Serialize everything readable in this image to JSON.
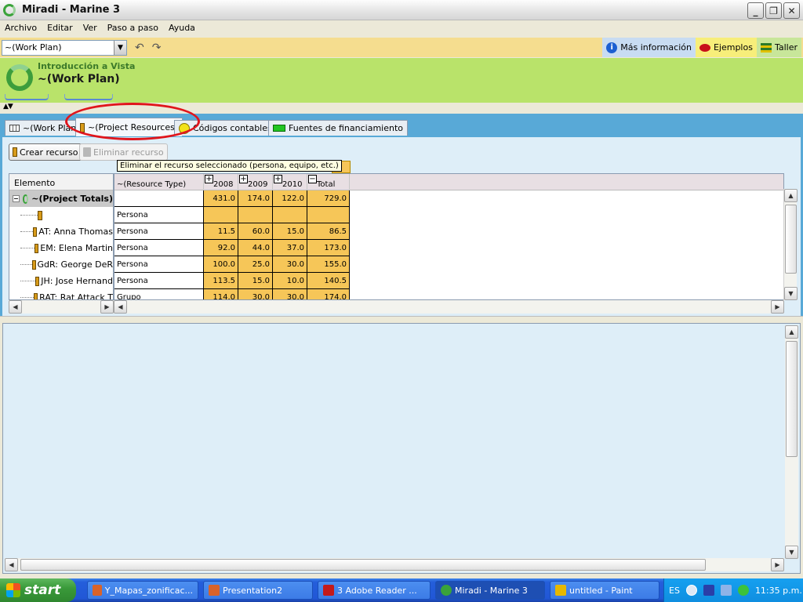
{
  "window": {
    "title": "Miradi - Marine 3"
  },
  "menu": [
    "Archivo",
    "Editar",
    "Ver",
    "Paso a paso",
    "Ayuda"
  ],
  "toolbar": {
    "view_select": "~(Work Plan)",
    "mas_info": "Más información",
    "ejemplos": "Ejemplos",
    "taller": "Taller"
  },
  "header": {
    "subtitle": "Introducción a Vista",
    "title": "~(Work Plan)"
  },
  "tabs": [
    "~(Work Plan)",
    "~(Project Resources)",
    "Códigos contables",
    "Fuentes de financiamiento"
  ],
  "actions": {
    "crear": "Crear recurso",
    "eliminar": "Eliminar recurso",
    "tooltip": "Eliminar el recurso seleccionado (persona, equipo, etc.)"
  },
  "tree": {
    "header": "Elemento",
    "rows": [
      "~(Project Totals)",
      "",
      "AT: Anna Thomas",
      "EM: Elena Martin",
      "GdR: George DeR",
      "JH: Jose Hernand",
      "RAT: Rat Attack T"
    ]
  },
  "grid": {
    "headers": {
      "type": "~(Resource Type)",
      "y2008": "2008",
      "y2009": "2009",
      "y2010": "2010",
      "total": "Total"
    },
    "rows": [
      {
        "type": "",
        "v2008": "431.0",
        "v2009": "174.0",
        "v2010": "122.0",
        "total": "729.0"
      },
      {
        "type": "Persona",
        "v2008": "",
        "v2009": "",
        "v2010": "",
        "total": ""
      },
      {
        "type": "Persona",
        "v2008": "11.5",
        "v2009": "60.0",
        "v2010": "15.0",
        "total": "86.5"
      },
      {
        "type": "Persona",
        "v2008": "92.0",
        "v2009": "44.0",
        "v2010": "37.0",
        "total": "173.0"
      },
      {
        "type": "Persona",
        "v2008": "100.0",
        "v2009": "25.0",
        "v2010": "30.0",
        "total": "155.0"
      },
      {
        "type": "Persona",
        "v2008": "113.5",
        "v2009": "15.0",
        "v2010": "10.0",
        "total": "140.5"
      },
      {
        "type": "Grupo",
        "v2008": "114.0",
        "v2009": "30.0",
        "v2010": "30.0",
        "total": "174.0"
      }
    ]
  },
  "taskbar": {
    "start": "start",
    "tasks": [
      "Y_Mapas_zonificac...",
      "Presentation2",
      "3 Adobe Reader ...",
      "Miradi - Marine 3",
      "untitled - Paint"
    ],
    "lang": "ES",
    "clock": "11:35 p.m."
  }
}
